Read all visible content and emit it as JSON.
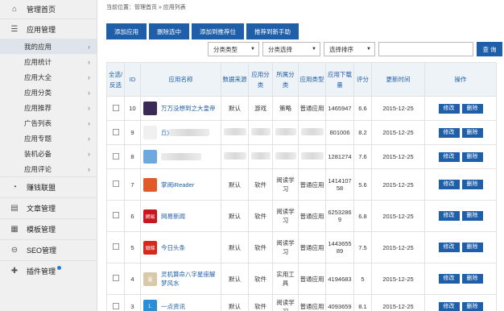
{
  "sidebar": {
    "home": {
      "label": "管理首页",
      "icon": "home-icon"
    },
    "app_mgmt": {
      "label": "应用管理",
      "icon": "menu-icon"
    },
    "sub_items": [
      {
        "label": "我的应用",
        "active": true
      },
      {
        "label": "应用统计"
      },
      {
        "label": "应用大全"
      },
      {
        "label": "应用分类"
      },
      {
        "label": "应用推荐"
      },
      {
        "label": "广告列表"
      },
      {
        "label": "应用专题"
      },
      {
        "label": "装机必备"
      },
      {
        "label": "应用评论"
      }
    ],
    "sections": [
      {
        "label": "赚钱联盟",
        "icon": "pie-chart-icon"
      },
      {
        "label": "文章管理",
        "icon": "document-icon"
      },
      {
        "label": "模板管理",
        "icon": "template-icon"
      },
      {
        "label": "SEO管理",
        "icon": "link-icon"
      },
      {
        "label": "插件管理",
        "icon": "puzzle-icon"
      }
    ]
  },
  "breadcrumb": {
    "text": "当前位置：管理首页 » 应用列表"
  },
  "toolbar": {
    "add": "添加应用",
    "delete_selected": "删除选中",
    "add_recommend": "添加到推荐位",
    "recommend_new": "推荐到新手助"
  },
  "filters": {
    "category_type": "分类类型",
    "category_select": "分类选择",
    "sort_select": "选择排序",
    "search_button": "查 询"
  },
  "table": {
    "headers": [
      "全选/反选",
      "ID",
      "应用名称",
      "数据来源",
      "应用分类",
      "所属分类",
      "应用类型",
      "应用下载量",
      "评分",
      "更新时间",
      "操作"
    ],
    "rows": [
      {
        "id": "10",
        "name": "万万没想到之大皇帝",
        "source": "默认",
        "cat": "游戏",
        "sub": "策略",
        "type": "普通应用",
        "downloads": "1465947",
        "score": "6.6",
        "date": "2015-12-25",
        "icon_color": "#3a2a55",
        "icon_text": ""
      },
      {
        "id": "9",
        "name": "丘)",
        "source": "",
        "cat": "",
        "sub": "",
        "type": "",
        "downloads": "801006",
        "score": "8.2",
        "date": "2015-12-25",
        "icon_color": "#f0f0f0",
        "icon_text": ""
      },
      {
        "id": "8",
        "name": "",
        "source": "",
        "cat": "",
        "sub": "",
        "type": "",
        "downloads": "1281274",
        "score": "7.6",
        "date": "2015-12-25",
        "icon_color": "#6fa8dc",
        "icon_text": ""
      },
      {
        "id": "7",
        "name": "掌阅iReader",
        "source": "默认",
        "cat": "软件",
        "sub": "阅读学习",
        "type": "普通应用",
        "downloads": "1414107 58",
        "score": "5.6",
        "date": "2015-12-25",
        "icon_color": "#e05a2a",
        "icon_text": ""
      },
      {
        "id": "6",
        "name": "网易新闻",
        "source": "默认",
        "cat": "软件",
        "sub": "阅读学习",
        "type": "普通应用",
        "downloads": "6253286 9",
        "score": "6.8",
        "date": "2015-12-25",
        "icon_color": "#c8161d",
        "icon_text": "網易"
      },
      {
        "id": "5",
        "name": "今日头条",
        "source": "默认",
        "cat": "软件",
        "sub": "阅读学习",
        "type": "普通应用",
        "downloads": "1443655 89",
        "score": "7.5",
        "date": "2015-12-25",
        "icon_color": "#d6281f",
        "icon_text": "頭條"
      },
      {
        "id": "4",
        "name": "灵机算命八字星座解梦风水",
        "source": "默认",
        "cat": "软件",
        "sub": "实用工具",
        "type": "普通应用",
        "downloads": "4194683",
        "score": "5",
        "date": "2015-12-25",
        "icon_color": "#d8c9a8",
        "icon_text": "靈"
      },
      {
        "id": "3",
        "name": "一点资讯",
        "source": "默认",
        "cat": "软件",
        "sub": "阅读学习",
        "type": "普通应用",
        "downloads": "4093659",
        "score": "8.1",
        "date": "2015-12-25",
        "icon_color": "#2a8fd6",
        "icon_text": "1."
      }
    ],
    "edit_label": "修改",
    "delete_label": "删除"
  }
}
